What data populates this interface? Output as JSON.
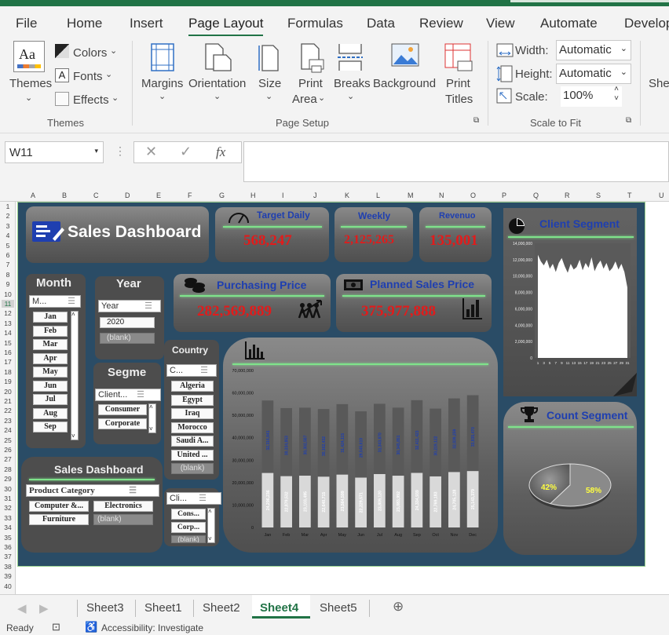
{
  "ribbon_tabs": [
    "File",
    "Home",
    "Insert",
    "Page Layout",
    "Formulas",
    "Data",
    "Review",
    "View",
    "Automate",
    "Develop"
  ],
  "themes_group": {
    "themes_label": "Themes",
    "colors": "Colors",
    "fonts": "Fonts",
    "effects": "Effects",
    "group_label": "Themes"
  },
  "page_setup": {
    "margins": "Margins",
    "orientation": "Orientation",
    "size": "Size",
    "print_area_1": "Print",
    "print_area_2": "Area",
    "breaks": "Breaks",
    "background": "Background",
    "print_titles_1": "Print",
    "print_titles_2": "Titles",
    "group_label": "Page Setup"
  },
  "scale_to_fit": {
    "width_label": "Width:",
    "width_value": "Automatic",
    "height_label": "Height:",
    "height_value": "Automatic",
    "scale_label": "Scale:",
    "scale_value": "100%",
    "group_label": "Scale to Fit",
    "sheet_cut": "She"
  },
  "name_box": "W11",
  "fx": "fx",
  "columns": [
    "A",
    "B",
    "C",
    "D",
    "E",
    "F",
    "G",
    "H",
    "I",
    "J",
    "K",
    "L",
    "M",
    "N",
    "O",
    "P",
    "Q",
    "R",
    "S",
    "T",
    "U"
  ],
  "rows": [
    "1",
    "2",
    "3",
    "4",
    "5",
    "6",
    "7",
    "8",
    "9",
    "10",
    "11",
    "12",
    "13",
    "14",
    "15",
    "16",
    "17",
    "18",
    "19",
    "20",
    "21",
    "22",
    "23",
    "24",
    "25",
    "26",
    "27",
    "28",
    "29",
    "30",
    "31",
    "32",
    "33",
    "34",
    "35",
    "36",
    "37",
    "38",
    "39",
    "40"
  ],
  "dashboard": {
    "title": "Sales Dashboard",
    "target_daily": {
      "label": "Target Daily",
      "value": "568,247"
    },
    "weekly": {
      "label": "Weekly",
      "value": "2,125,265"
    },
    "revenue": {
      "label": "Revenuo",
      "value": "135,001"
    },
    "purchasing": {
      "label": "Purchasing Price",
      "value": "282,569,889"
    },
    "planned": {
      "label": "Planned Sales Price",
      "value": "375,977,888"
    },
    "client_segment_title": "Client Segment",
    "count_segment_title": "Count Segment",
    "pie": {
      "a": "42%",
      "b": "58%",
      "a_fraction": 0.42,
      "b_fraction": 0.58
    }
  },
  "slicers": {
    "month": {
      "title": "Month",
      "filter": "M...",
      "items": [
        "Jan",
        "Feb",
        "Mar",
        "Apr",
        "May",
        "Jun",
        "Jul",
        "Aug",
        "Sep"
      ]
    },
    "year": {
      "title": "Year",
      "filter": "Year",
      "items": [
        "2020",
        "(blank)"
      ]
    },
    "segment": {
      "title": "Segme",
      "filter": "Client...",
      "items": [
        "Consumer",
        "Corporate"
      ]
    },
    "country": {
      "title": "Country",
      "filter": "C...",
      "items": [
        "Algeria",
        "Egypt",
        "Iraq",
        "Morocco",
        "Saudi A...",
        "United ...",
        "(blank)"
      ]
    },
    "product": {
      "title": "Sales Dashboard",
      "filter": "Product Category",
      "items": [
        "Computer &...",
        "Electronics",
        "Furniture",
        "(blank)"
      ]
    },
    "client": {
      "filter": "Cli...",
      "items": [
        "Cons...",
        "Corp...",
        "(blank)"
      ]
    }
  },
  "chart_data": [
    {
      "type": "bar",
      "title": "",
      "categories": [
        "Jan",
        "Feb",
        "Mar",
        "Apr",
        "May",
        "Jun",
        "Jul",
        "Aug",
        "Sep",
        "Oct",
        "Nov",
        "Dec"
      ],
      "series": [
        {
          "values": [
            24296236,
            22879532,
            23103495,
            22640715,
            23564599,
            22229571,
            23809120,
            23083992,
            24334939,
            22769183,
            24705128,
            25143379
          ]
        },
        {
          "values": [
            32316841,
            30334853,
            30302587,
            30162432,
            31424115,
            29545610,
            31343870,
            30345851,
            32411423,
            30219122,
            32839259,
            33835470
          ]
        }
      ],
      "y_ticks": [
        "0",
        "10,000,000",
        "20,000,000",
        "30,000,000",
        "40,000,000",
        "50,000,000",
        "60,000,000",
        "70,000,000"
      ],
      "ylim": [
        0,
        70000000
      ],
      "colors": [
        "#d9d9d9",
        "#595959"
      ]
    },
    {
      "type": "area",
      "title": "",
      "y_ticks": [
        "0",
        "2,000,000",
        "4,000,000",
        "6,000,000",
        "8,000,000",
        "10,000,000",
        "12,000,000",
        "14,000,000"
      ],
      "x_ticks": [
        "1",
        "3",
        "5",
        "7",
        "9",
        "11",
        "13",
        "15",
        "17",
        "19",
        "21",
        "23",
        "25",
        "27",
        "29",
        "31"
      ],
      "ylim": [
        0,
        14000000
      ],
      "values": [
        12600000,
        11800000,
        11300000,
        12000000,
        10900000,
        11500000,
        10500000,
        11600000,
        12200000,
        11200000,
        10400000,
        11500000,
        10800000,
        11100000,
        12000000,
        10700000,
        11600000,
        11000000,
        12300000,
        10600000,
        11400000,
        11900000,
        10900000,
        11600000,
        10600000,
        11000000,
        11800000,
        10800000,
        11500000,
        10500000,
        8600000
      ]
    }
  ],
  "sheets": [
    "Sheet3",
    "Sheet1",
    "Sheet2",
    "Sheet4",
    "Sheet5"
  ],
  "active_sheet": "Sheet4",
  "status": {
    "ready": "Ready",
    "accessibility": "Accessibility: Investigate"
  }
}
